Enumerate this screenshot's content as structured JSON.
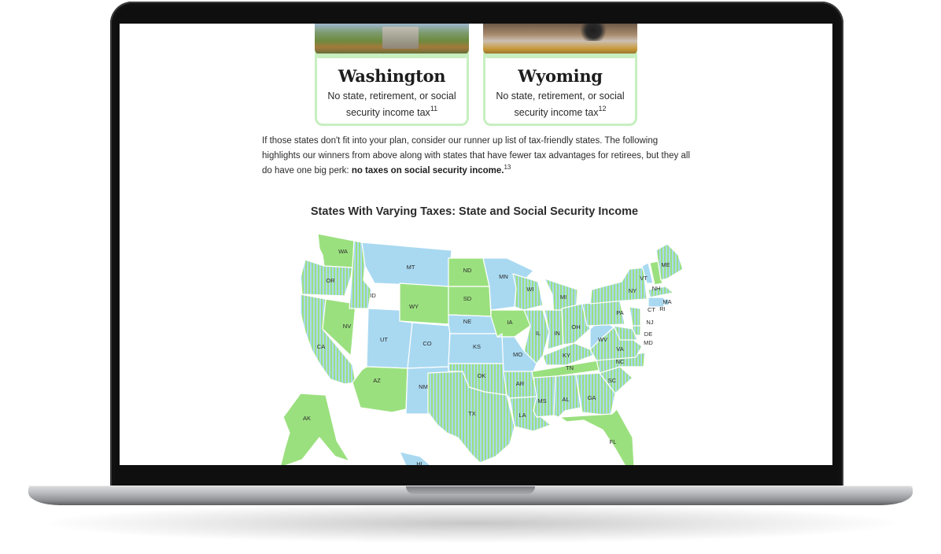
{
  "cards": [
    {
      "state": "Washington",
      "text": "No state, retirement, or social security income tax",
      "footnote": "11"
    },
    {
      "state": "Wyoming",
      "text": "No state, retirement, or social security income tax",
      "footnote": "12"
    }
  ],
  "paragraph": {
    "text": "If those states don't fit into your plan, consider our runner up list of tax-friendly states. The following highlights our winners from above along with states that have fewer tax advantages for retirees, but they all do have one big perk: ",
    "bold": "no taxes on social security income.",
    "footnote": "13"
  },
  "map": {
    "title": "States With Varying Taxes: State and Social Security Income",
    "colors": {
      "green": "#9be07f",
      "blue": "#a9d9f1",
      "stripe_a": "#9be07f",
      "stripe_b": "#a9d9f1"
    },
    "states": [
      {
        "abbr": "WA",
        "category": "green"
      },
      {
        "abbr": "OR",
        "category": "striped"
      },
      {
        "abbr": "CA",
        "category": "striped"
      },
      {
        "abbr": "NV",
        "category": "green"
      },
      {
        "abbr": "ID",
        "category": "striped"
      },
      {
        "abbr": "MT",
        "category": "blue"
      },
      {
        "abbr": "WY",
        "category": "green"
      },
      {
        "abbr": "UT",
        "category": "blue"
      },
      {
        "abbr": "CO",
        "category": "blue"
      },
      {
        "abbr": "AZ",
        "category": "green"
      },
      {
        "abbr": "NM",
        "category": "blue"
      },
      {
        "abbr": "ND",
        "category": "green"
      },
      {
        "abbr": "SD",
        "category": "green"
      },
      {
        "abbr": "NE",
        "category": "blue"
      },
      {
        "abbr": "KS",
        "category": "blue"
      },
      {
        "abbr": "OK",
        "category": "striped"
      },
      {
        "abbr": "TX",
        "category": "striped"
      },
      {
        "abbr": "MN",
        "category": "blue"
      },
      {
        "abbr": "IA",
        "category": "green"
      },
      {
        "abbr": "MO",
        "category": "blue"
      },
      {
        "abbr": "AR",
        "category": "striped"
      },
      {
        "abbr": "LA",
        "category": "striped"
      },
      {
        "abbr": "WI",
        "category": "striped"
      },
      {
        "abbr": "IL",
        "category": "striped"
      },
      {
        "abbr": "MI",
        "category": "striped"
      },
      {
        "abbr": "IN",
        "category": "striped"
      },
      {
        "abbr": "OH",
        "category": "striped"
      },
      {
        "abbr": "KY",
        "category": "striped"
      },
      {
        "abbr": "TN",
        "category": "green"
      },
      {
        "abbr": "MS",
        "category": "striped"
      },
      {
        "abbr": "AL",
        "category": "striped"
      },
      {
        "abbr": "GA",
        "category": "striped"
      },
      {
        "abbr": "FL",
        "category": "green"
      },
      {
        "abbr": "SC",
        "category": "striped"
      },
      {
        "abbr": "NC",
        "category": "striped"
      },
      {
        "abbr": "VA",
        "category": "striped"
      },
      {
        "abbr": "WV",
        "category": "blue"
      },
      {
        "abbr": "PA",
        "category": "striped"
      },
      {
        "abbr": "NY",
        "category": "striped"
      },
      {
        "abbr": "VT",
        "category": "blue"
      },
      {
        "abbr": "NH",
        "category": "green"
      },
      {
        "abbr": "ME",
        "category": "striped"
      },
      {
        "abbr": "MA",
        "category": "striped"
      },
      {
        "abbr": "RI",
        "category": "blue"
      },
      {
        "abbr": "CT",
        "category": "blue"
      },
      {
        "abbr": "NJ",
        "category": "striped"
      },
      {
        "abbr": "DE",
        "category": "striped"
      },
      {
        "abbr": "MD",
        "category": "striped"
      },
      {
        "abbr": "AK",
        "category": "green"
      },
      {
        "abbr": "HI",
        "category": "blue"
      }
    ]
  }
}
